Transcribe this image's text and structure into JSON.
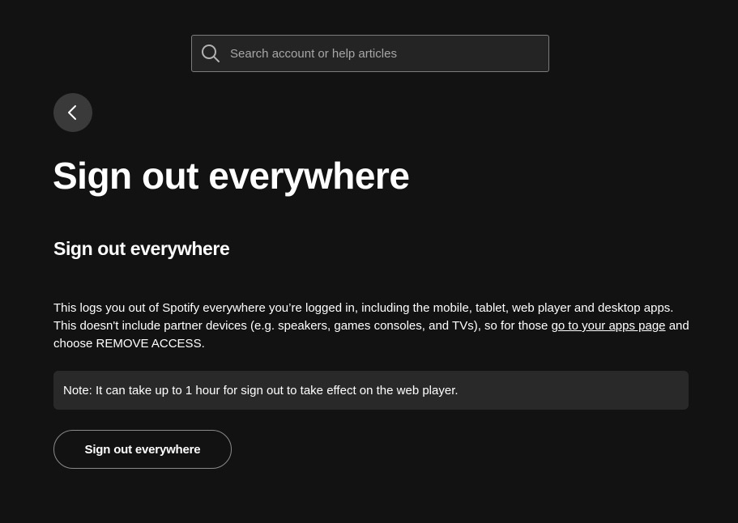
{
  "search": {
    "placeholder": "Search account or help articles",
    "value": "",
    "icon": "search-icon"
  },
  "navigation": {
    "back_icon": "chevron-left-icon"
  },
  "page": {
    "title": "Sign out everywhere",
    "section_title": "Sign out everywhere",
    "body_before_link": "This logs you out of Spotify everywhere you’re logged in, including the mobile, tablet, web player and desktop apps. This doesn't include partner devices (e.g. speakers, games consoles, and TVs), so for those ",
    "body_link": "go to your apps page",
    "body_after_link": " and choose REMOVE ACCESS.",
    "note": "Note: It can take up to 1 hour for sign out to take effect on the web player.",
    "button_label": "Sign out everywhere"
  },
  "colors": {
    "background": "#121212",
    "search_background": "#242424",
    "search_border": "#7c7c7c",
    "back_button": "#3a3a3a",
    "note_background": "#292929",
    "text": "#ffffff",
    "placeholder": "#a7a7a7"
  }
}
